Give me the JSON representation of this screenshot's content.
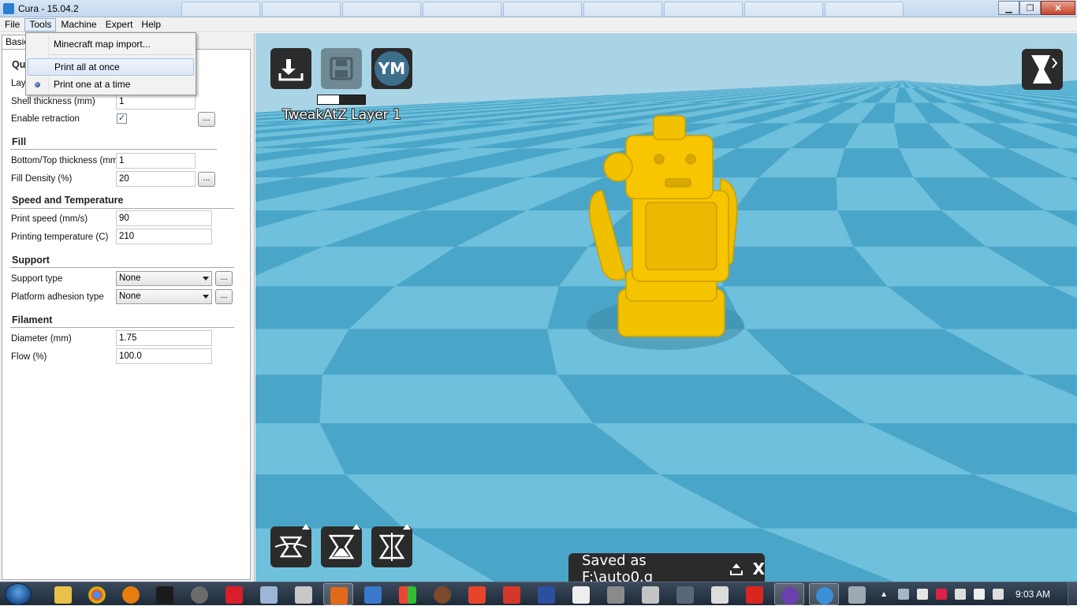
{
  "window": {
    "title": "Cura - 15.04.2"
  },
  "menubar": {
    "items": [
      "File",
      "Tools",
      "Machine",
      "Expert",
      "Help"
    ]
  },
  "tools_menu": {
    "items": [
      "Minecraft map import...",
      "Print all at once",
      "Print one at a time"
    ],
    "highlighted": "Print all at once",
    "selected_radio": "Print one at a time"
  },
  "tabs": {
    "basic": "Basic"
  },
  "settings": {
    "quality": {
      "title": "Qu",
      "layer_label": "Laye",
      "shell_label": "Shell thickness (mm)",
      "shell_value": "1",
      "retraction_label": "Enable retraction",
      "retraction_checked": "✓"
    },
    "fill": {
      "title": "Fill",
      "bottom_top_label": "Bottom/Top thickness (mm)",
      "bottom_top_value": "1",
      "density_label": "Fill Density (%)",
      "density_value": "20"
    },
    "speed": {
      "title": "Speed and Temperature",
      "print_speed_label": "Print speed (mm/s)",
      "print_speed_value": "90",
      "temp_label": "Printing temperature (C)",
      "temp_value": "210"
    },
    "support": {
      "title": "Support",
      "type_label": "Support type",
      "type_value": "None",
      "adhesion_label": "Platform adhesion type",
      "adhesion_value": "None"
    },
    "filament": {
      "title": "Filament",
      "diameter_label": "Diameter (mm)",
      "diameter_value": "1.75",
      "flow_label": "Flow (%)",
      "flow_value": "100.0"
    },
    "ellipsis": "..."
  },
  "viewport": {
    "ym_label": "YM",
    "layer_text": "TweakAtZ Layer 1",
    "progress": 0.45,
    "saved_text": "Saved as F:\\auto0.g",
    "close_label": "X",
    "model_color": "#f5c400",
    "floor_color_dark": "#4aa6c8",
    "floor_color_light": "#6fc0dc"
  },
  "taskbar": {
    "time": "9:03 AM"
  }
}
